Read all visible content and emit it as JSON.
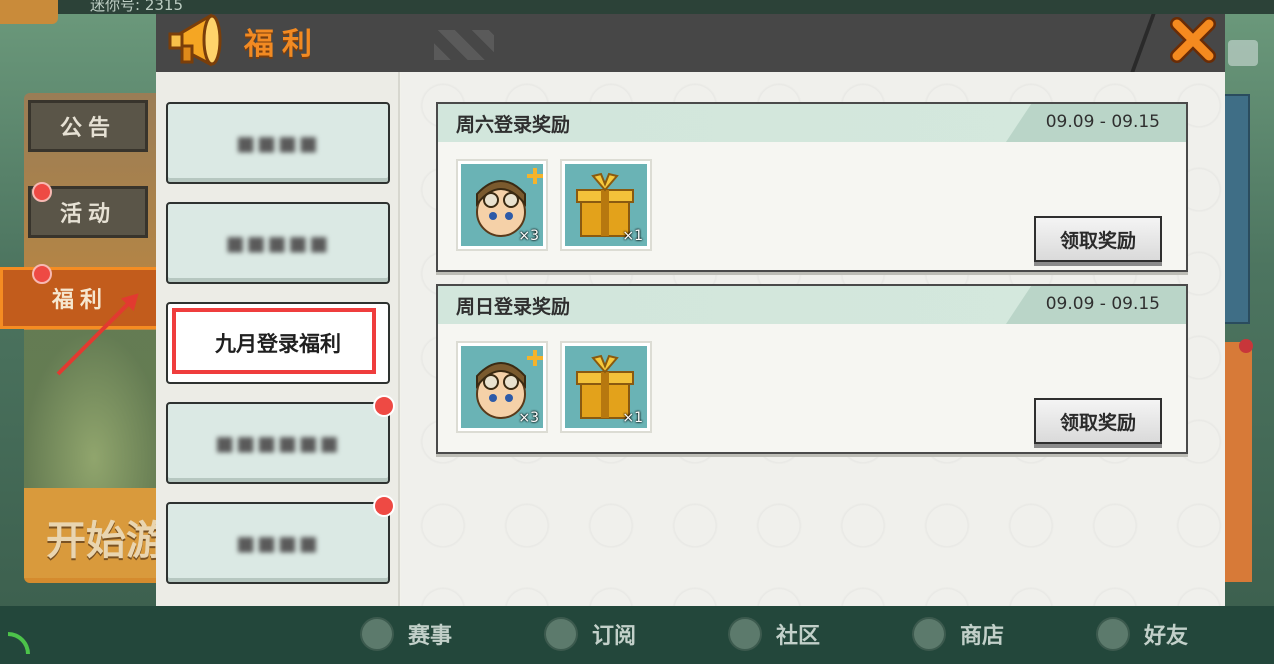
{
  "background": {
    "account_label": "迷你号: 2315",
    "start_banner": "开始游",
    "side_tabs": [
      "公告",
      "活动",
      "福利"
    ],
    "bottom_nav": [
      {
        "label": "赛事",
        "icon": "trophy-icon"
      },
      {
        "label": "订阅",
        "icon": "subscribe-star-icon"
      },
      {
        "label": "社区",
        "icon": "community-icon"
      },
      {
        "label": "商店",
        "icon": "shop-cart-icon"
      },
      {
        "label": "好友",
        "icon": "friends-icon"
      }
    ]
  },
  "modal": {
    "title": "福利",
    "close_icon": "close-x-icon",
    "categories": [
      {
        "label": "",
        "blurred": true,
        "has_dot": false
      },
      {
        "label": "",
        "blurred": true,
        "has_dot": false
      },
      {
        "label": "九月登录福利",
        "blurred": false,
        "has_dot": false,
        "selected": true
      },
      {
        "label": "",
        "blurred": true,
        "has_dot": true
      },
      {
        "label": "",
        "blurred": true,
        "has_dot": true
      }
    ],
    "rewards": [
      {
        "title": "周六登录奖励",
        "date": "09.09 - 09.15",
        "items": [
          {
            "icon": "character-avatar-icon",
            "count": "×3"
          },
          {
            "icon": "gold-gift-box-icon",
            "count": "×1"
          }
        ],
        "button": "领取奖励"
      },
      {
        "title": "周日登录奖励",
        "date": "09.09 - 09.15",
        "items": [
          {
            "icon": "character-avatar-icon",
            "count": "×3"
          },
          {
            "icon": "gold-gift-box-icon",
            "count": "×1"
          }
        ],
        "button": "领取奖励"
      }
    ]
  },
  "colors": {
    "accent_orange": "#f28a22",
    "badge_red": "#ee4a44",
    "highlight_red": "#ef3d3d",
    "card_header_green": "#d2e6dc"
  }
}
